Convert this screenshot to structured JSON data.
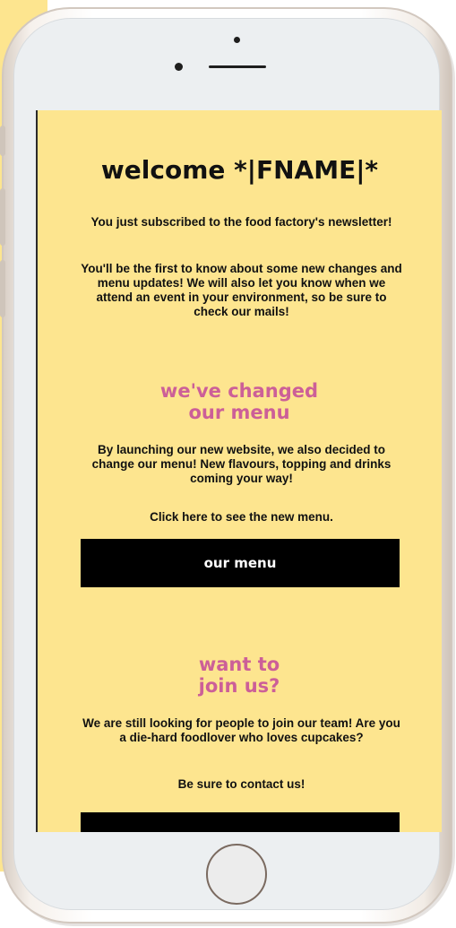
{
  "email": {
    "welcome_title": "welcome *|FNAME|*",
    "intro_line": "You just subscribed to the food factory's newsletter!",
    "intro_body": "You'll be the first to know about some new changes and menu updates! We will also let you know when we attend an event in your environment, so be sure to check our mails!",
    "menu_section": {
      "heading": "we've changed\nour menu",
      "body": "By launching our new website, we also decided to change our menu! New flavours, topping and drinks coming your way!",
      "cta_text": "Click here to see the new menu.",
      "button_label": "our menu"
    },
    "join_section": {
      "heading": "want to\njoin us?",
      "body": "We are still looking for people to join our team! Are you a die-hard foodlover who loves cupcakes?",
      "cta_text": "Be sure to contact us!"
    }
  },
  "colors": {
    "background": "#fde58f",
    "heading_accent": "#cc5f98",
    "button": "#000000",
    "button_text": "#ffffff"
  }
}
